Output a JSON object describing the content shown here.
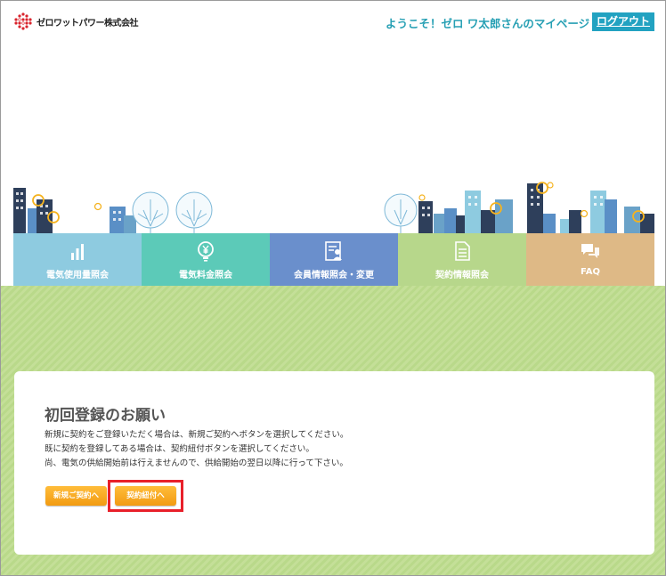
{
  "header": {
    "logo_text": "ゼロワットパワー株式会社",
    "welcome": "ようこそ！ゼロ ワ太郎さんのマイページ",
    "logout_label": "ログアウト"
  },
  "nav": {
    "items": [
      {
        "label": "電気使用量照会",
        "icon": "bar-chart-icon",
        "color": "#8ecbe0"
      },
      {
        "label": "電気料金照会",
        "icon": "yen-bulb-icon",
        "color": "#5ccab8"
      },
      {
        "label": "会員情報照会・変更",
        "icon": "member-card-icon",
        "color": "#6a8fcc"
      },
      {
        "label": "契約情報照会",
        "icon": "document-icon",
        "color": "#b7d78b"
      },
      {
        "label": "FAQ",
        "icon": "chat-bubbles-icon",
        "color": "#deb986"
      }
    ]
  },
  "card": {
    "title": "初回登録のお願い",
    "lines": [
      "新規に契約をご登録いただく場合は、新規ご契約へボタンを選択してください。",
      "既に契約を登録してある場合は、契約紐付ボタンを選択してください。",
      "尚、電気の供給開始前は行えませんので、供給開始の翌日以降に行って下さい。"
    ],
    "new_contract_label": "新規ご契約へ",
    "link_contract_label": "契約紐付へ"
  },
  "colors": {
    "accent": "#22a2c1",
    "button": "#f7a91f",
    "highlight": "#e8202a",
    "background_green": "#bcdb8f"
  }
}
